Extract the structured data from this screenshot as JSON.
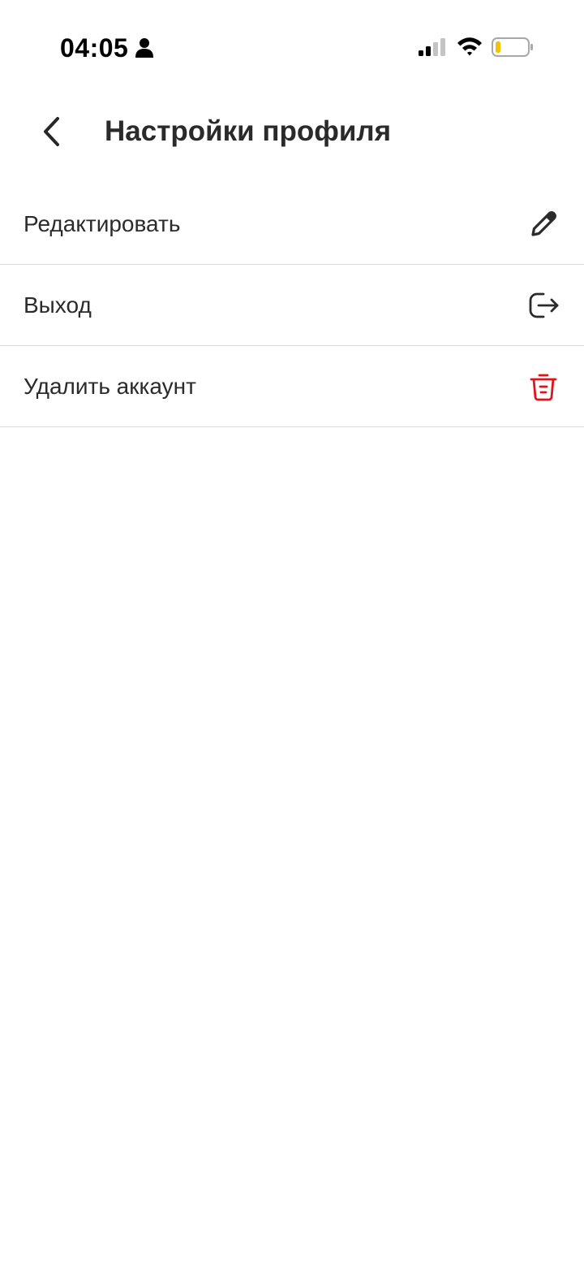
{
  "status_bar": {
    "time": "04:05",
    "battery_color": "#f2c300"
  },
  "header": {
    "title": "Настройки профиля",
    "back_icon": "chevron-left-icon"
  },
  "menu": {
    "items": [
      {
        "label": "Редактировать",
        "icon": "pencil-icon",
        "color": "#2b2b2b"
      },
      {
        "label": "Выход",
        "icon": "logout-icon",
        "color": "#2b2b2b"
      },
      {
        "label": "Удалить аккаунт",
        "icon": "trash-icon",
        "color": "#e0151b"
      }
    ]
  }
}
